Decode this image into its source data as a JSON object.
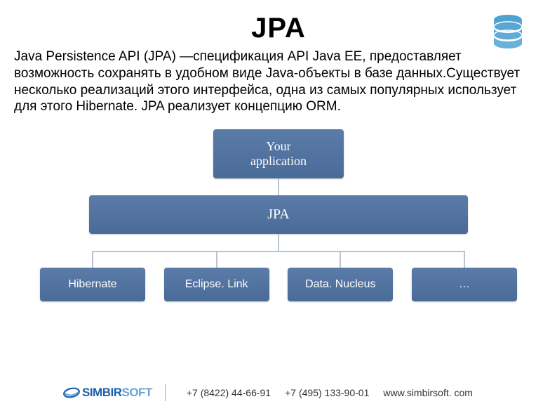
{
  "title": "JPA",
  "description": "Java Persistence API (JPA) —спецификация API Java EE, предоставляет возможность сохранять в удобном виде Java-объекты в базе данных.Существует несколько реализаций этого интерфейса, одна из самых популярных использует для этого Hibernate. JPA реализует концепцию ORM.",
  "icon": "database-icon",
  "colors": {
    "node_gradient_top": "#5b7ba8",
    "node_gradient_bottom": "#4a6a98",
    "connector": "#b9c4d1",
    "db_icon": "#4fa3d1"
  },
  "diagram": {
    "root": {
      "label": "Your\napplication"
    },
    "mid": {
      "label": "JPA"
    },
    "leaves": [
      {
        "label": "Hibernate"
      },
      {
        "label": "Eclipse. Link"
      },
      {
        "label": "Data. Nucleus"
      },
      {
        "label": "…"
      }
    ]
  },
  "footer": {
    "logo_part1": "SIMBIR",
    "logo_part2": "SOFT",
    "phone1": "+7 (8422) 44-66-91",
    "phone2": "+7 (495) 133-90-01",
    "url": "www.simbirsoft. com"
  }
}
